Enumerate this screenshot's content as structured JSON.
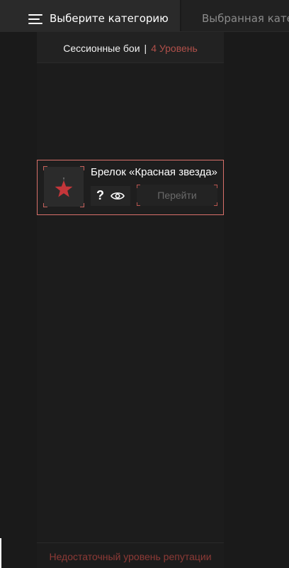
{
  "tabs": {
    "select_category": "Выберите категорию",
    "selected_category": "Выбранная категория"
  },
  "section": {
    "title": "Сессионные бои",
    "separator": "|",
    "level": "4 Уровень"
  },
  "item": {
    "title": "Брелок «Красная звезда»",
    "help_symbol": "?",
    "go_label": "Перейти",
    "icon": "red-star-icon"
  },
  "footer": {
    "message": "Недостаточный уровень репутации"
  },
  "colors": {
    "background": "#1a1a1a",
    "accent": "#d9706a",
    "level_text": "#b0504a",
    "warning_text": "#8d3a36",
    "star": "#c4363a"
  }
}
